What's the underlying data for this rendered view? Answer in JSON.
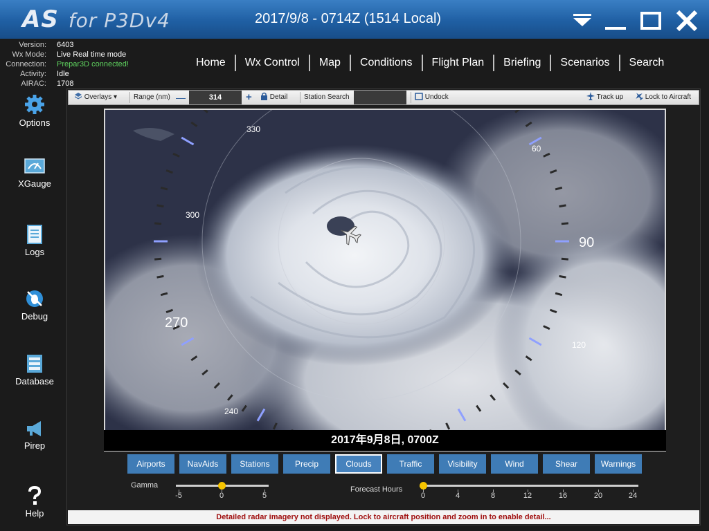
{
  "titlebar": {
    "logo_as": "AS",
    "logo_for": "for P3Dv4",
    "title": "2017/9/8 - 0714Z (1514 Local)",
    "icons": [
      "menu-dropdown-icon",
      "minimize-icon",
      "maximize-icon",
      "close-icon"
    ]
  },
  "status": [
    {
      "label": "Version:",
      "value": "6403"
    },
    {
      "label": "Wx Mode:",
      "value": "Live Real time mode"
    },
    {
      "label": "Connection:",
      "value": "Prepar3D connected!"
    },
    {
      "label": "Activity:",
      "value": "Idle"
    },
    {
      "label": "AIRAC:",
      "value": "1708"
    }
  ],
  "colors": {
    "connected": "#5fd35f",
    "accent_blue": "#3f7cb6",
    "warning_red": "#a01010",
    "knob": "#f6c400"
  },
  "nav": [
    "Home",
    "Wx Control",
    "Map",
    "Conditions",
    "Flight Plan",
    "Briefing",
    "Scenarios",
    "Search"
  ],
  "sidebar": [
    {
      "label": "Options",
      "icon": "gear-icon"
    },
    {
      "label": "XGauge",
      "icon": "gauge-icon"
    },
    {
      "label": "Logs",
      "icon": "document-icon"
    },
    {
      "label": "Debug",
      "icon": "bug-icon"
    },
    {
      "label": "Database",
      "icon": "database-icon"
    },
    {
      "label": "Pirep",
      "icon": "megaphone-icon"
    },
    {
      "label": "Help",
      "icon": "question-icon"
    }
  ],
  "toolbar": {
    "overlays": "Overlays",
    "range_label": "Range (nm)",
    "range_value": "314",
    "detail": "Detail",
    "station_search": "Station Search",
    "undock": "Undock",
    "track_up": "Track up",
    "lock_aircraft": "Lock to Aircraft"
  },
  "map": {
    "caption": "2017年9月8日, 0700Z",
    "compass_labels": [
      "330",
      "60",
      "300",
      "90",
      "270",
      "120",
      "240"
    ],
    "aircraft_icon": "airplane-icon"
  },
  "layers": {
    "buttons": [
      "Airports",
      "NavAids",
      "Stations",
      "Precip",
      "Clouds",
      "Traffic",
      "Visibility",
      "Wind",
      "Shear",
      "Warnings"
    ],
    "active": "Clouds"
  },
  "gamma": {
    "label": "Gamma",
    "ticks": [
      "-5",
      "0",
      "5"
    ],
    "value": 0
  },
  "forecast": {
    "label": "Forecast Hours",
    "ticks": [
      "0",
      "4",
      "8",
      "12",
      "16",
      "20",
      "24"
    ],
    "value": 0
  },
  "statusbar": {
    "message": "Detailed radar imagery not displayed. Lock to aircraft position and zoom in to enable detail..."
  }
}
